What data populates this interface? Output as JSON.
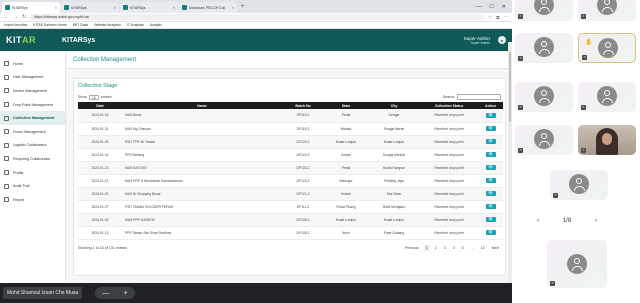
{
  "browser": {
    "tabs": [
      {
        "label": "KITARSys",
        "active": true
      },
      {
        "label": "KITARSys",
        "active": false
      },
      {
        "label": "KITARSys",
        "active": false
      },
      {
        "label": "Download: PED-DF.Coll",
        "active": false
      }
    ],
    "url": "https://kitarsys.mahb.gov.my/kt-bs/",
    "bookmarks": [
      "Import favorites",
      "KITAR Sahamn Home",
      "BRT Dasb",
      "Website Analytics",
      "IT Analytics",
      "Analytic"
    ]
  },
  "app": {
    "logo_main": "KIT",
    "logo_accent": "AR",
    "name": "KITARSys",
    "user_name": "Super Admin",
    "user_role": "Super Admin"
  },
  "sidebar": {
    "items": [
      {
        "label": "Home",
        "active": false
      },
      {
        "label": "User Management",
        "active": false
      },
      {
        "label": "Device Management",
        "active": false
      },
      {
        "label": "Drop Point Management",
        "active": false
      },
      {
        "label": "Collection Management",
        "active": true
      },
      {
        "label": "Donor Management",
        "active": false
      },
      {
        "label": "Logistic Collaborator",
        "active": false
      },
      {
        "label": "Recycling Collaborator",
        "active": false
      },
      {
        "label": "Profile",
        "active": false
      },
      {
        "label": "Audit Trail",
        "active": false
      },
      {
        "label": "Report",
        "active": false
      }
    ]
  },
  "main": {
    "page_title": "Collection Management",
    "card_title": "Collection Stage",
    "show_prefix": "Show",
    "show_value": "10",
    "show_suffix": "entries",
    "search_label": "Search:",
    "columns": [
      "Date",
      "Name",
      "Batch No",
      "State",
      "City",
      "Collection Status",
      "Action"
    ],
    "rows": [
      [
        "2024-01-16",
        "MAS Bewd",
        "DP115-2",
        "Perak",
        "Gerigar",
        "Received drop point",
        "👁"
      ],
      [
        "2024-01-31",
        "MAS Ng Charuan",
        "DP115-2",
        "Melaka",
        "Sungai Merah",
        "Received drop point",
        "👁"
      ],
      [
        "2024-01-29",
        "PSD TPR Jln Tandai",
        "DP120-1",
        "Kuala Lumpur",
        "Kuala Lumpur",
        "Received drop point",
        "👁"
      ],
      [
        "2024-01-24",
        "PPS Bertang",
        "DP120-2",
        "Kedah",
        "Sungai Merbok",
        "Received drop point",
        "👁"
      ],
      [
        "2024-01-23",
        "MAS KAYONG",
        "DP133-2",
        "Perak",
        "Kuala Kangsar",
        "Received drop point",
        "👁"
      ],
      [
        "2024-01-21",
        "MAS PPR Jl Hendramin Kamaruzaman",
        "DP123-2",
        "Selangor",
        "Petaling Jaya",
        "Received drop point",
        "👁"
      ],
      [
        "2024-01-20",
        "MAS Bt Shopping Bunai",
        "DP121-2",
        "Kedah",
        "Alor Setar",
        "Received drop point",
        "👁"
      ],
      [
        "2024-01-27",
        "PSD TAMAN SOLODER PERAH",
        "DP111-2",
        "Pulau Pinang",
        "Bukit Mertajam",
        "Received drop point",
        "👁"
      ],
      [
        "2024-01-02",
        "MAS PPR GAHEOK",
        "DP108-2",
        "Kuala Lumpur",
        "Kuala Lumpur",
        "Received drop point",
        "👁"
      ],
      [
        "2024-01-13",
        "PPS Taman Seri Sinar Reclines",
        "DP105-2",
        "Johor",
        "Pasir Gudang",
        "Received drop point",
        "👁"
      ]
    ],
    "footer_info": "Showing 1 to 10 of 131 entries",
    "pager": {
      "previous": "Previous",
      "pages": [
        "1",
        "2",
        "3",
        "4",
        "5",
        "...",
        "14"
      ],
      "current": "1",
      "next": "Next"
    }
  },
  "participants": {
    "page_indicator": "1/8",
    "prev_icon": "chevron-left-icon",
    "next_icon": "chevron-right-icon"
  },
  "meeting": {
    "presenter_name": "Mohd Shamsul Izuan Che Musa",
    "zoom_minus": "—",
    "zoom_plus": "+"
  },
  "colors": {
    "brand": "#0f5a58",
    "accent": "#8fd14f",
    "link": "#1a8f8a",
    "action": "#17a2b8"
  }
}
